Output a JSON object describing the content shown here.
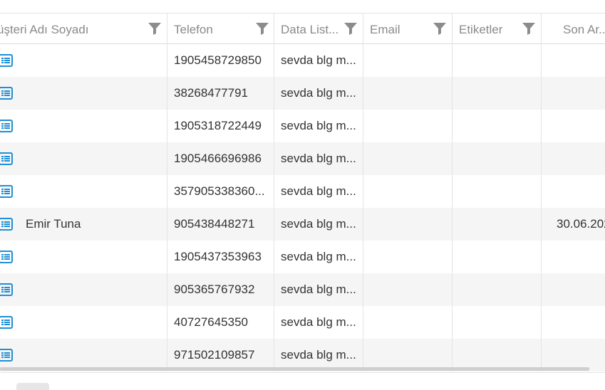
{
  "columns": [
    {
      "label": "üşteri Adı Soyadı"
    },
    {
      "label": "Telefon"
    },
    {
      "label": "Data List..."
    },
    {
      "label": "Email"
    },
    {
      "label": "Etiketler"
    },
    {
      "label": "Son Ar..."
    }
  ],
  "rows": [
    {
      "name": "",
      "phone": "1905458729850",
      "data_list": "sevda blg m...",
      "email": "",
      "tags": "",
      "last": ""
    },
    {
      "name": "",
      "phone": "38268477791",
      "data_list": "sevda blg m...",
      "email": "",
      "tags": "",
      "last": ""
    },
    {
      "name": "",
      "phone": "1905318722449",
      "data_list": "sevda blg m...",
      "email": "",
      "tags": "",
      "last": ""
    },
    {
      "name": "",
      "phone": "1905466696986",
      "data_list": "sevda blg m...",
      "email": "",
      "tags": "",
      "last": ""
    },
    {
      "name": "",
      "phone": "357905338360...",
      "data_list": "sevda blg m...",
      "email": "",
      "tags": "",
      "last": ""
    },
    {
      "name": "Emir Tuna",
      "phone": "905438448271",
      "data_list": "sevda blg m...",
      "email": "",
      "tags": "",
      "last": "30.06.202"
    },
    {
      "name": "",
      "phone": "1905437353963",
      "data_list": "sevda blg m...",
      "email": "",
      "tags": "",
      "last": ""
    },
    {
      "name": "",
      "phone": "905365767932",
      "data_list": "sevda blg m...",
      "email": "",
      "tags": "",
      "last": ""
    },
    {
      "name": "",
      "phone": "40727645350",
      "data_list": "sevda blg m...",
      "email": "",
      "tags": "",
      "last": ""
    },
    {
      "name": "",
      "phone": "971502109857",
      "data_list": "sevda blg m...",
      "email": "",
      "tags": "",
      "last": ""
    }
  ],
  "colors": {
    "icon": "#1f8fd6",
    "filter": "#8c8c8c",
    "alt_row": "#f5f5f5"
  },
  "icons": {
    "row_icon": "card-details-icon",
    "header_icon": "filter-icon"
  }
}
